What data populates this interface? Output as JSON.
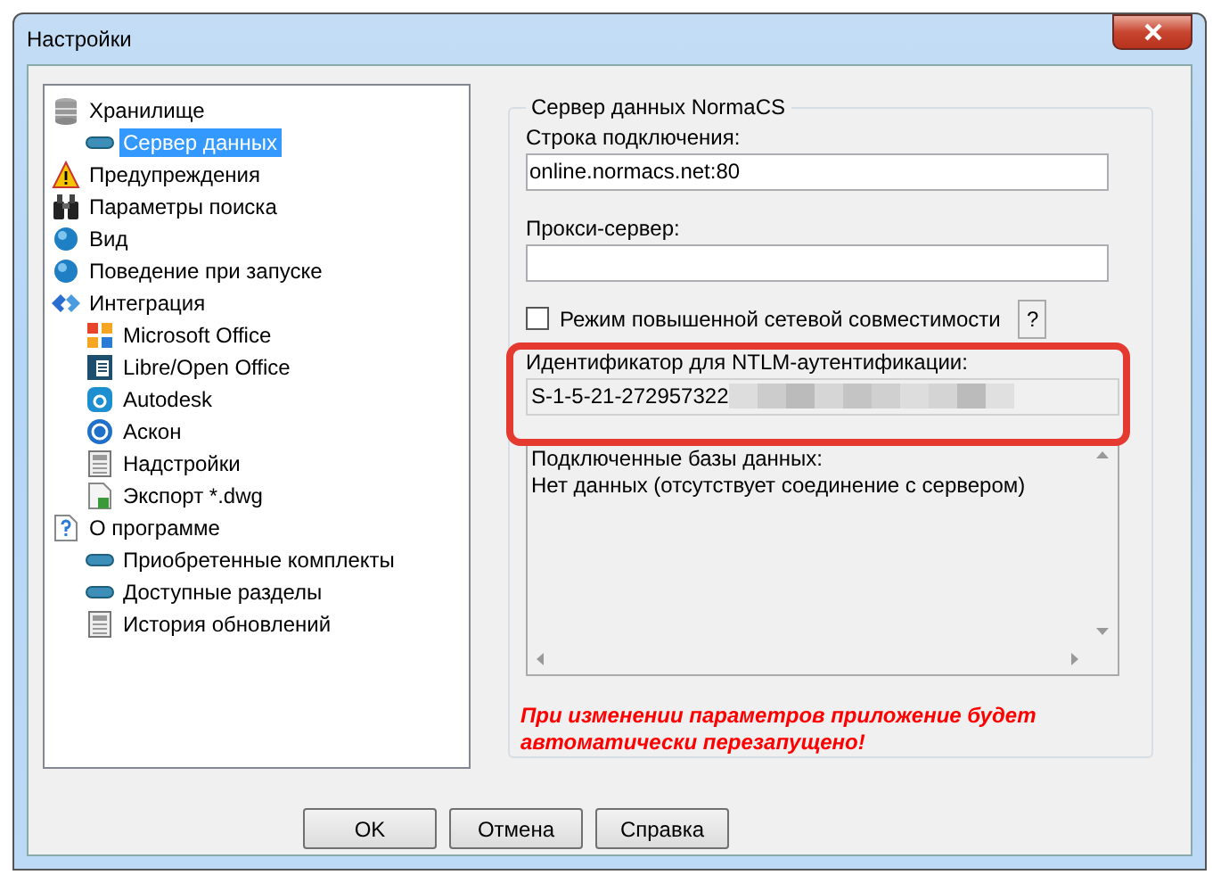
{
  "window": {
    "title": "Настройки"
  },
  "tree": [
    {
      "label": "Хранилище",
      "kind": "database",
      "selected": false,
      "children": [
        {
          "label": "Сервер данных",
          "kind": "pill",
          "selected": true
        }
      ]
    },
    {
      "label": "Предупреждения",
      "kind": "warning",
      "selected": false
    },
    {
      "label": "Параметры поиска",
      "kind": "binoculars",
      "selected": false
    },
    {
      "label": "Вид",
      "kind": "sphere",
      "selected": false
    },
    {
      "label": "Поведение при запуске",
      "kind": "sphere",
      "selected": false
    },
    {
      "label": "Интеграция",
      "kind": "diamonds",
      "selected": false,
      "children": [
        {
          "label": "Microsoft Office",
          "kind": "squares",
          "selected": false
        },
        {
          "label": "Libre/Open Office",
          "kind": "document",
          "selected": false
        },
        {
          "label": "Autodesk",
          "kind": "letter",
          "selected": false
        },
        {
          "label": "Аскон",
          "kind": "circle",
          "selected": false
        },
        {
          "label": "Надстройки",
          "kind": "calculator",
          "selected": false
        },
        {
          "label": "Экспорт *.dwg",
          "kind": "export",
          "selected": false
        }
      ]
    },
    {
      "label": "О программе",
      "kind": "help",
      "selected": false,
      "children": [
        {
          "label": "Приобретенные комплекты",
          "kind": "pill",
          "selected": false
        },
        {
          "label": "Доступные разделы",
          "kind": "pill",
          "selected": false
        },
        {
          "label": "История обновлений",
          "kind": "calculator",
          "selected": false
        }
      ]
    }
  ],
  "server_group": {
    "title": "Сервер данных NormaCS",
    "connection": {
      "label": "Строка подключения:",
      "value": "online.normacs.net:80"
    },
    "proxy": {
      "label": "Прокси-сервер:"
    },
    "compat": {
      "label": "Режим повышенной сетевой совместимости",
      "checked": false,
      "help": "?"
    },
    "ntlm": {
      "label": "Идентификатор для NTLM-аутентификации:",
      "value": "S-1-5-21-272957322"
    },
    "databases": [
      "Подключенные базы данных:",
      "Нет данных (отсутствует соединение с сервером)"
    ],
    "warning": "При изменении параметров приложение будет автоматически перезапущено!"
  },
  "buttons": [
    "OK",
    "Отмена",
    "Справка"
  ]
}
